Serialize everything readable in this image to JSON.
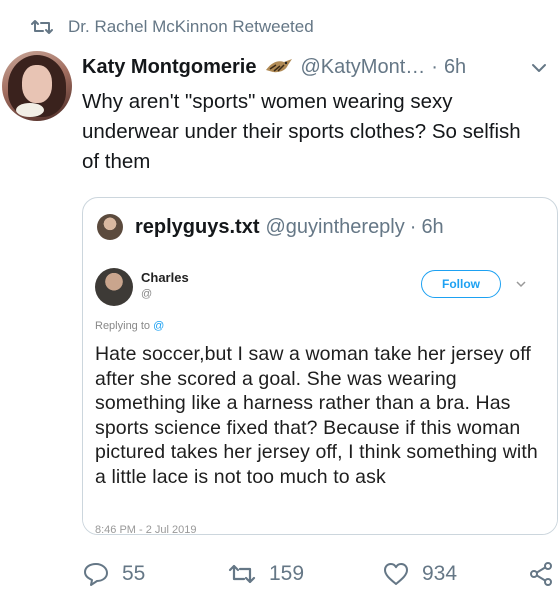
{
  "retweet": {
    "text": "Dr. Rachel McKinnon Retweeted",
    "icon": "retweet-icon"
  },
  "tweet": {
    "display_name": "Katy Montgomerie",
    "handle": "@KatyMont…",
    "separator": "·",
    "time": "6h",
    "text": "Why aren't \"sports\" women wearing sexy underwear under their sports clothes? So selfish of them",
    "badge_icon": "hen-harrier-bird-icon"
  },
  "quote": {
    "display_name": "replyguys.txt",
    "handle": "@guyinthereply",
    "separator": "·",
    "time": "6h",
    "screenshot": {
      "author": "Charles",
      "author_handle": "@",
      "follow_label": "Follow",
      "replying_prefix": "Replying to",
      "replying_handle": "@",
      "body": "Hate soccer,but I saw a woman take her jersey off after she scored a goal. She was wearing something like a harness rather than a bra. Has sports science fixed that? Because if this woman pictured takes her jersey off, I think something with a little lace is not too much to ask",
      "date": "8:46 PM - 2 Jul 2019"
    }
  },
  "actions": {
    "replies": "55",
    "retweets": "159",
    "likes": "934"
  },
  "colors": {
    "text": "#14171a",
    "muted": "#657786",
    "accent": "#1da1f2",
    "border": "#ccd6dd"
  }
}
